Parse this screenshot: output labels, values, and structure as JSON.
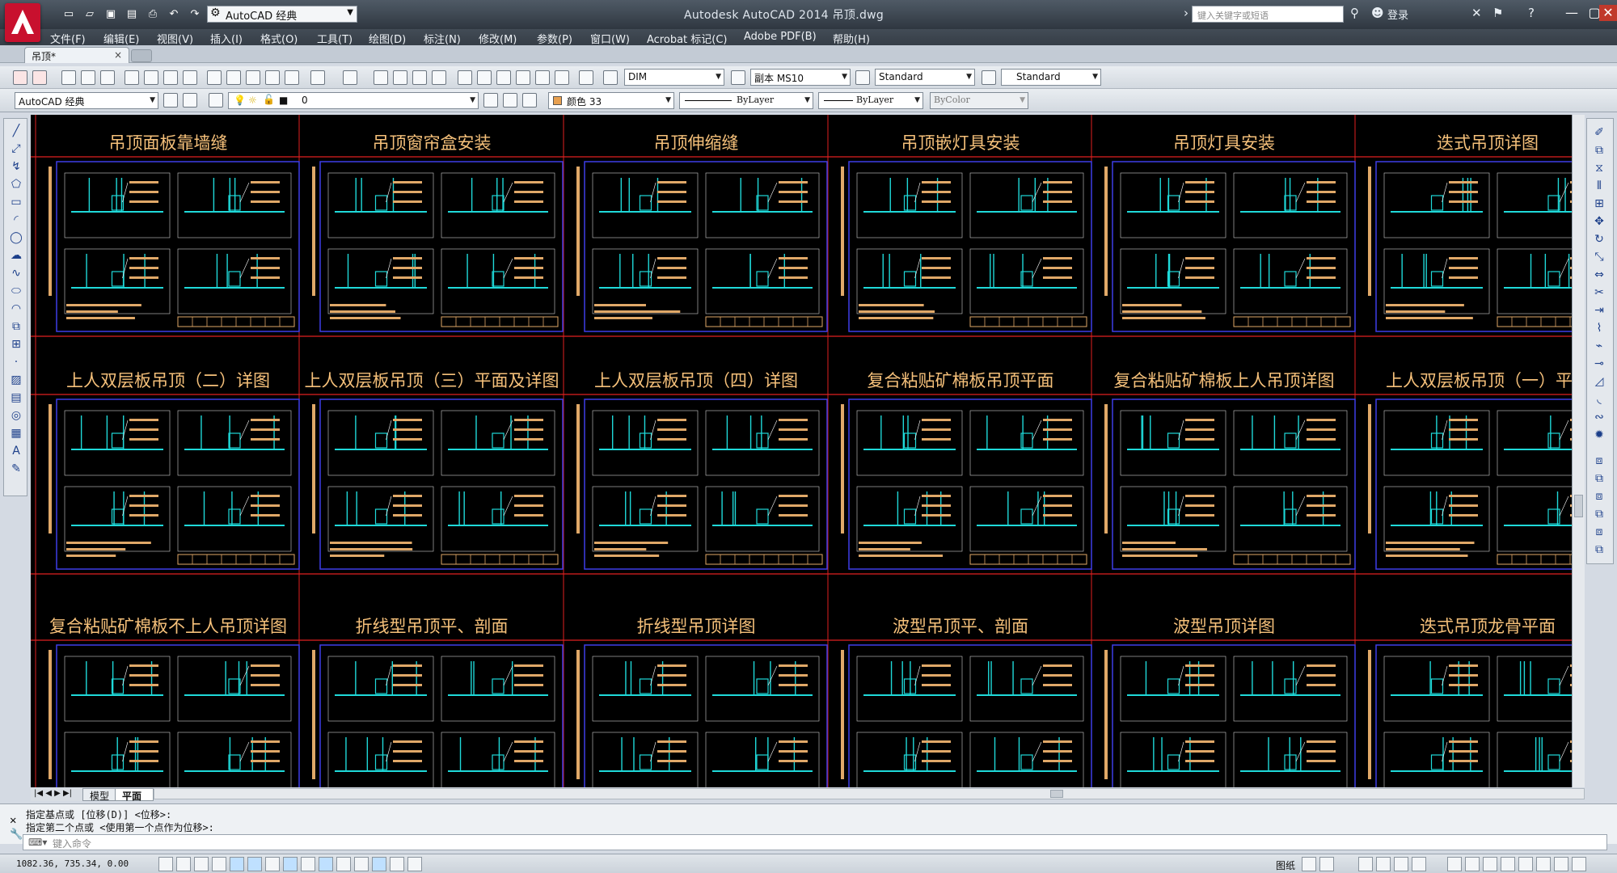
{
  "titlebar": {
    "workspace": "AutoCAD 经典",
    "app_title": "Autodesk AutoCAD 2014    吊顶.dwg",
    "search_placeholder": "键入关键字或短语",
    "login_label": "登录"
  },
  "menu": [
    "文件(F)",
    "编辑(E)",
    "视图(V)",
    "插入(I)",
    "格式(O)",
    "工具(T)",
    "绘图(D)",
    "标注(N)",
    "修改(M)",
    "参数(P)",
    "窗口(W)",
    "Acrobat 标记(C)",
    "Adobe PDF(B)",
    "帮助(H)"
  ],
  "doc_tab": {
    "label": "吊顶*",
    "close": "×"
  },
  "toolbar": {
    "dimstyle": "DIM",
    "textstyle": "副本 MS10",
    "tablestyle": "Standard",
    "multileader_style": "Standard",
    "workspace2": "AutoCAD 经典",
    "layer": "0",
    "color": "颜色 33",
    "linetype": "ByLayer",
    "lineweight": "ByLayer",
    "plotstyle": "ByColor"
  },
  "sheets": [
    {
      "title": "吊顶面板靠墙缝"
    },
    {
      "title": "吊顶窗帘盒安装"
    },
    {
      "title": "吊顶伸缩缝"
    },
    {
      "title": "吊顶嵌灯具安装"
    },
    {
      "title": "吊顶灯具安装"
    },
    {
      "title": "迭式吊顶详图"
    },
    {
      "title": "上人双层板吊顶（二）详图"
    },
    {
      "title": "上人双层板吊顶（三）平面及详图"
    },
    {
      "title": "上人双层板吊顶（四）详图"
    },
    {
      "title": "复合粘贴矿棉板吊顶平面"
    },
    {
      "title": "复合粘贴矿棉板上人吊顶详图"
    },
    {
      "title": "上人双层板吊顶（一）平面"
    },
    {
      "title": "复合粘贴矿棉板不上人吊顶详图"
    },
    {
      "title": "折线型吊顶平、剖面"
    },
    {
      "title": "折线型吊顶详图"
    },
    {
      "title": "波型吊顶平、剖面"
    },
    {
      "title": "波型吊顶详图"
    },
    {
      "title": "迭式吊顶龙骨平面"
    }
  ],
  "layout_tabs": {
    "model": "模型",
    "layout": "平面图"
  },
  "command": {
    "line1": "指定基点或 [位移(D)] <位移>:",
    "line2": "指定第二个点或 <使用第一个点作为位移>:",
    "input_placeholder": "键入命令"
  },
  "status": {
    "coords": "1082.36, 735.34, 0.00",
    "paper_label": "图纸"
  },
  "colors": {
    "canvas": "#000000",
    "title_text": "#f5c07a",
    "frame": "#3d3de8",
    "cyan": "#1fd9d9",
    "tan": "#e0a868",
    "red_grid": "#e02020"
  }
}
